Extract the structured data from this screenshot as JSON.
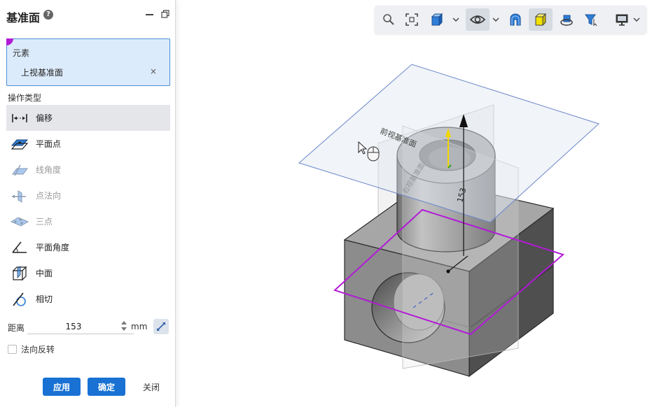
{
  "panel": {
    "title": "基准面",
    "help": "?",
    "element": {
      "label": "元素",
      "item": "上视基准面",
      "remove": "×"
    },
    "op_type_label": "操作类型",
    "op_types": [
      {
        "label": "偏移",
        "icon": "offset-icon",
        "state": "selected"
      },
      {
        "label": "平面点",
        "icon": "plane-point-icon",
        "state": "enabled"
      },
      {
        "label": "线角度",
        "icon": "line-angle-icon",
        "state": "disabled"
      },
      {
        "label": "点法向",
        "icon": "point-normal-icon",
        "state": "disabled"
      },
      {
        "label": "三点",
        "icon": "three-point-icon",
        "state": "disabled"
      },
      {
        "label": "平面角度",
        "icon": "plane-angle-icon",
        "state": "enabled"
      },
      {
        "label": "中面",
        "icon": "mid-plane-icon",
        "state": "enabled"
      },
      {
        "label": "相切",
        "icon": "tangent-icon",
        "state": "enabled"
      }
    ],
    "distance": {
      "label": "距离",
      "value": "153",
      "unit": "mm"
    },
    "flip": {
      "label": "法向反转",
      "checked": false
    },
    "buttons": {
      "apply": "应用",
      "ok": "确定",
      "close": "关闭"
    }
  },
  "viewport": {
    "plane_labels": {
      "front": "前视基准面",
      "right": "右视基准面"
    },
    "dimension": "153",
    "colors": {
      "selection": "#b21bd6",
      "plane_edge": "#6b86c9",
      "triad_y": "#f2d600"
    }
  },
  "toolbar": {
    "buttons": [
      {
        "icon": "zoom-icon"
      },
      {
        "icon": "fit-view-icon"
      },
      {
        "icon": "view-cube-icon"
      },
      {
        "icon": "visibility-icon"
      },
      {
        "icon": "section-view-icon"
      },
      {
        "icon": "display-style-icon"
      },
      {
        "icon": "rotate-view-icon"
      },
      {
        "icon": "selection-filter-icon"
      },
      {
        "icon": "display-settings-icon"
      }
    ]
  }
}
